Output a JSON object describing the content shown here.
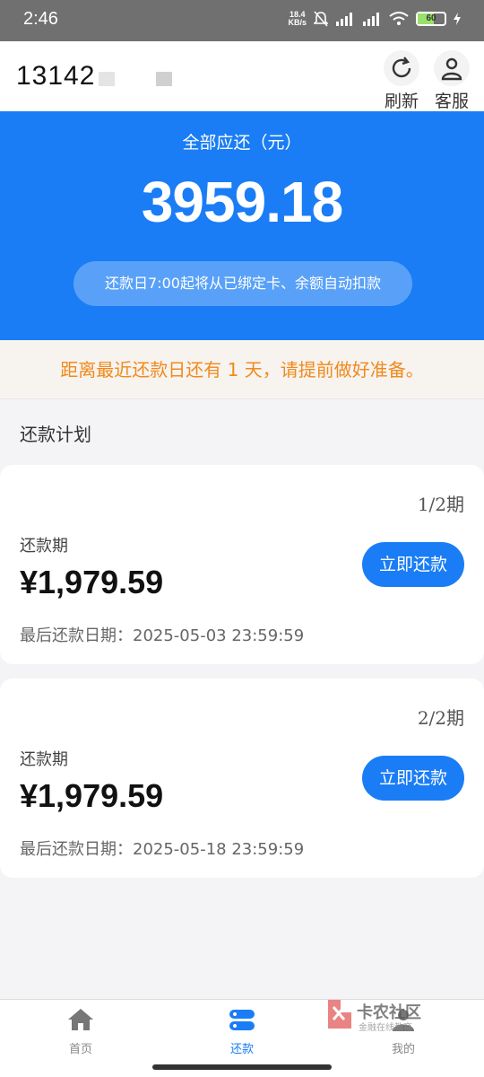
{
  "status_bar": {
    "time": "2:46",
    "net_speed_top": "18.4",
    "net_speed_bottom": "KB/s",
    "battery": "60"
  },
  "header": {
    "account": "13142",
    "refresh_label": "刷新",
    "refresh_icon": "refresh-icon",
    "service_label": "客服",
    "service_icon": "person-icon"
  },
  "hero": {
    "label": "全部应还（元）",
    "amount": "3959.18",
    "notice": "还款日7:00起将从已绑定卡、余额自动扣款"
  },
  "reminder": "距离最近还款日还有 1 天，请提前做好准备。",
  "plan": {
    "title": "还款计划",
    "items": [
      {
        "period": "1/2期",
        "label": "还款期",
        "amount": "¥1,979.59",
        "due": "最后还款日期：2025-05-03 23:59:59",
        "button": "立即还款"
      },
      {
        "period": "2/2期",
        "label": "还款期",
        "amount": "¥1,979.59",
        "due": "最后还款日期：2025-05-18 23:59:59",
        "button": "立即还款"
      }
    ]
  },
  "tabs": [
    {
      "label": "首页",
      "icon": "home-icon"
    },
    {
      "label": "还款",
      "icon": "repay-icon",
      "active": true
    },
    {
      "label": "我的",
      "icon": "user-icon"
    }
  ],
  "watermark": {
    "title": "卡农社区",
    "subtitle": "金融在线教育"
  },
  "colors": {
    "primary": "#1a7df5",
    "warning": "#f08a1c"
  }
}
